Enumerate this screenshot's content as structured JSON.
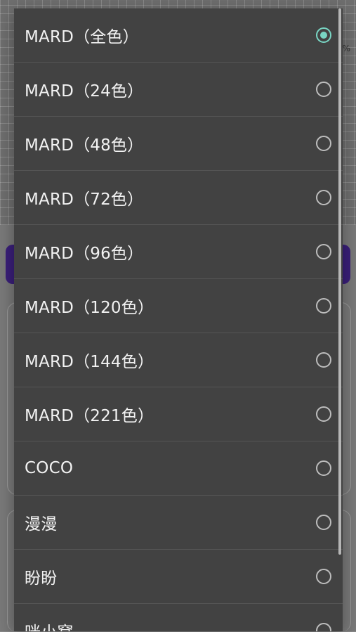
{
  "background": {
    "percent_fragment": "%",
    "accent_strip_color": "#3a1f7a"
  },
  "dialog": {
    "items": [
      {
        "label": "MARD（全色）",
        "checked": true
      },
      {
        "label": "MARD（24色）",
        "checked": false
      },
      {
        "label": "MARD（48色）",
        "checked": false
      },
      {
        "label": "MARD（72色）",
        "checked": false
      },
      {
        "label": "MARD（96色）",
        "checked": false
      },
      {
        "label": "MARD（120色）",
        "checked": false
      },
      {
        "label": "MARD（144色）",
        "checked": false
      },
      {
        "label": "MARD（221色）",
        "checked": false
      },
      {
        "label": "COCO",
        "checked": false
      },
      {
        "label": "漫漫",
        "checked": false
      },
      {
        "label": "盼盼",
        "checked": false
      },
      {
        "label": "咪小窝",
        "checked": false
      }
    ],
    "radio_checked_color": "#79d6c4",
    "radio_unchecked_color": "#bdbdbd"
  }
}
